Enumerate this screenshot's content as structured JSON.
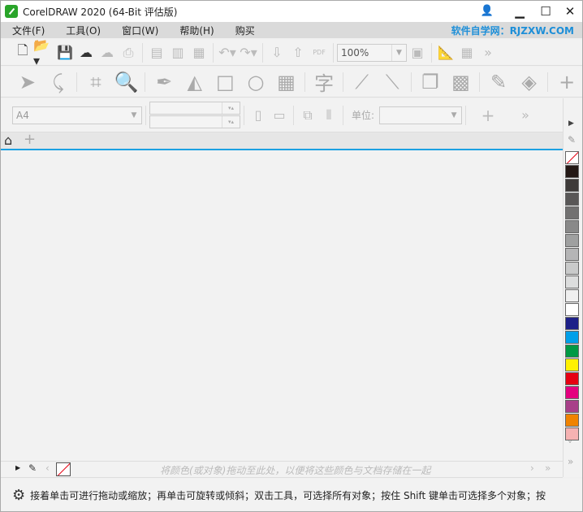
{
  "window": {
    "title": "CorelDRAW 2020 (64-Bit 评估版)",
    "minimize": "▁",
    "maximize": "☐",
    "close": "✕"
  },
  "menu": {
    "items": [
      "文件(F)",
      "工具(O)",
      "窗口(W)",
      "帮助(H)",
      "购买"
    ],
    "brand": "软件自学网：RJZXW.COM"
  },
  "toolbar": {
    "zoom": "100%",
    "pdf": "PDF"
  },
  "property_bar": {
    "page_size": "A4",
    "unit_label": "单位:",
    "unit_value": ""
  },
  "document_palette": {
    "hint": "将颜色(或对象)拖动至此处，以便将这些颜色与文档存储在一起"
  },
  "status": {
    "text": "接着单击可进行拖动或缩放；再单击可旋转或倾斜；双击工具，可选择所有对象；按住 Shift 键单击可选择多个对象；按"
  },
  "palette": {
    "colors": [
      "#231815",
      "#3e3a39",
      "#595757",
      "#727171",
      "#898989",
      "#9fa0a0",
      "#b5b5b6",
      "#c9caca",
      "#dcdddd",
      "#efefef",
      "#ffffff",
      "#1d2088",
      "#00a0e9",
      "#009944",
      "#fff100",
      "#e60012",
      "#e4007f",
      "#a84089",
      "#f08300",
      "#f5b2b2"
    ]
  }
}
